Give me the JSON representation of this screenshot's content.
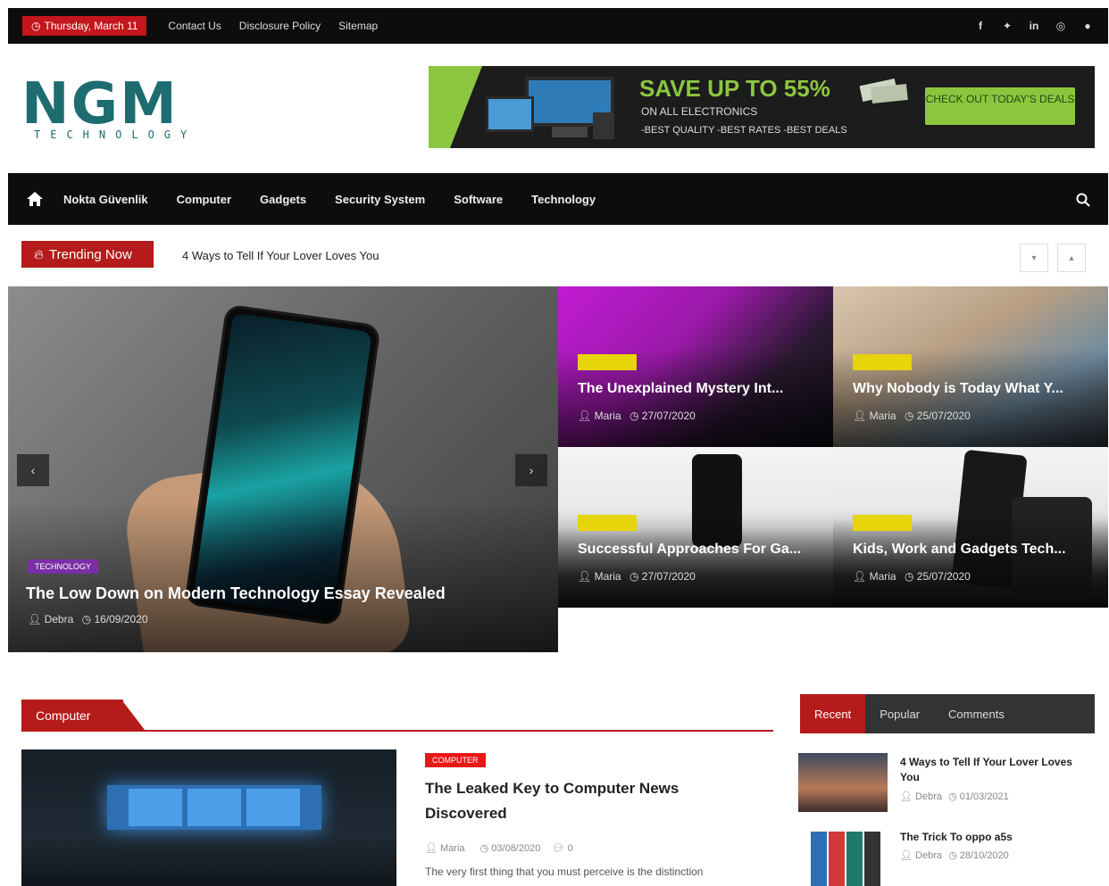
{
  "topbar": {
    "date": "Thursday, March 11",
    "links": [
      "Contact Us",
      "Disclosure Policy",
      "Sitemap"
    ],
    "social": [
      "facebook-icon",
      "twitter-icon",
      "linkedin-icon",
      "instagram-icon",
      "pinterest-icon"
    ]
  },
  "logo": {
    "main": "NGM",
    "sub": "TECHNOLOGY"
  },
  "banner": {
    "title": "SAVE UP TO 55%",
    "line1": "ON ALL ELECTRONICS",
    "line2": "-BEST QUALITY -BEST RATES -BEST DEALS",
    "cta": "CHECK OUT TODAY'S DEALS"
  },
  "nav": {
    "items": [
      "Nokta Güvenlik",
      "Computer",
      "Gadgets",
      "Security System",
      "Software",
      "Technology"
    ]
  },
  "trending": {
    "label": "Trending Now",
    "headline": "4 Ways to Tell If Your Lover Loves You"
  },
  "hero": {
    "category": "TECHNOLOGY",
    "title": "The Low Down on Modern Technology Essay Revealed",
    "author": "Debra",
    "date": "16/09/2020"
  },
  "tiles": [
    {
      "title": "The Unexplained Mystery Int...",
      "author": "Maria",
      "date": "27/07/2020"
    },
    {
      "title": "Why Nobody is Today What Y...",
      "author": "Maria",
      "date": "25/07/2020"
    },
    {
      "title": "Successful Approaches For Ga...",
      "author": "Maria",
      "date": "27/07/2020"
    },
    {
      "title": "Kids, Work and Gadgets Tech...",
      "author": "Maria",
      "date": "25/07/2020"
    }
  ],
  "computer_section": {
    "heading": "Computer",
    "category": "COMPUTER",
    "title": "The Leaked Key to Computer News Discovered",
    "author": "Maria",
    "date": "03/08/2020",
    "comments": "0",
    "excerpt": "The very first thing that you must perceive is the distinction"
  },
  "sidebar": {
    "tabs": [
      "Recent",
      "Popular",
      "Comments"
    ],
    "posts": [
      {
        "title": "4 Ways to Tell If Your Lover Loves You",
        "author": "Debra",
        "date": "01/03/2021"
      },
      {
        "title": "The Trick To oppo a5s",
        "author": "Debra",
        "date": "28/10/2020"
      }
    ]
  },
  "colors": {
    "accent_red": "#b51b1b",
    "dark": "#0d0d0d",
    "logo_teal": "#1c6c70",
    "banner_green": "#8cc63f",
    "tile_tag_yellow": "#e8d40a",
    "hero_tag_purple": "#7b2fa6"
  }
}
